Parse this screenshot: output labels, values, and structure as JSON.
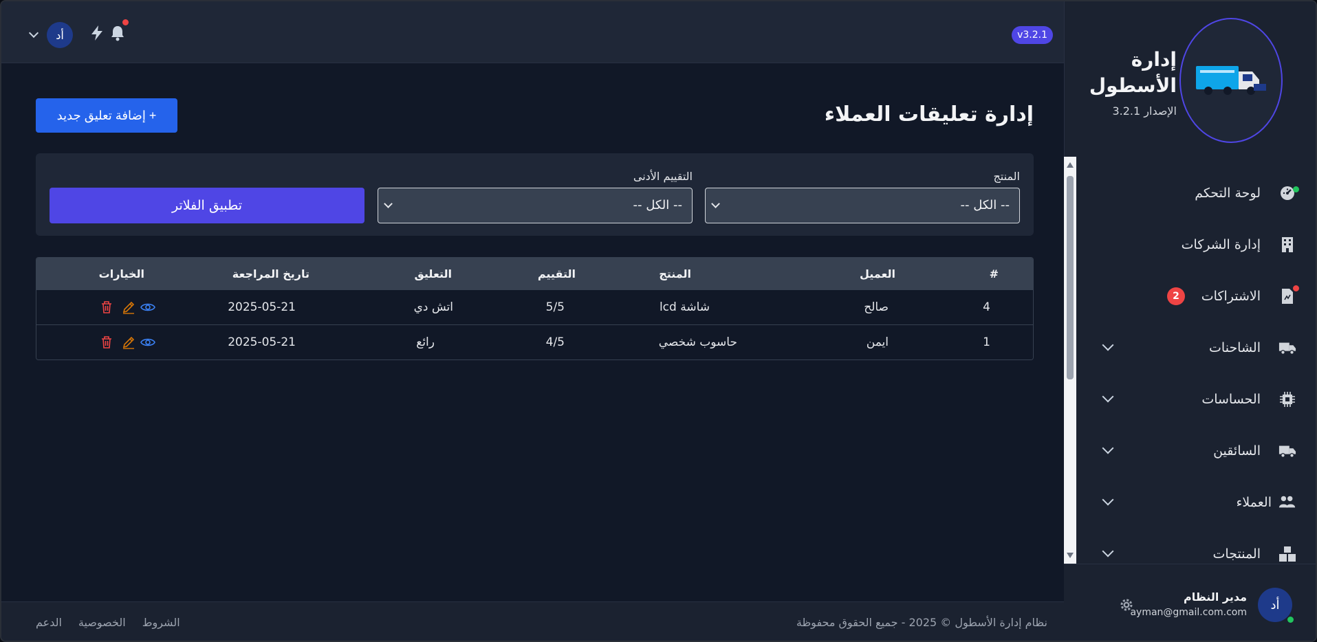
{
  "topbar": {
    "version_badge": "v3.2.1",
    "avatar_initials": "أد"
  },
  "brand": {
    "title": "إدارة الأسطول",
    "version": "الإصدار 3.2.1"
  },
  "nav": {
    "items": [
      {
        "label": "لوحة التحكم",
        "icon": "dashboard-icon"
      },
      {
        "label": "إدارة الشركات",
        "icon": "building-icon"
      },
      {
        "label": "الاشتراكات",
        "icon": "document-icon",
        "badge": "2"
      },
      {
        "label": "الشاحنات",
        "icon": "truck-icon"
      },
      {
        "label": "الحساسات",
        "icon": "chip-icon"
      },
      {
        "label": "السائقين",
        "icon": "truck-icon"
      },
      {
        "label": "العملاء",
        "icon": "users-icon"
      },
      {
        "label": "المنتجات",
        "icon": "boxes-icon"
      }
    ]
  },
  "user": {
    "avatar_initials": "أد",
    "name": "مدير النظام",
    "email": "ayman@gmail.com.com"
  },
  "page": {
    "title": "إدارة تعليقات العملاء",
    "add_button": "+ إضافة تعليق جديد"
  },
  "filters": {
    "product_label": "المنتج",
    "product_value": "-- الكل --",
    "rating_label": "التقييم الأدنى",
    "rating_value": "-- الكل --",
    "apply_button": "تطبيق الفلاتر"
  },
  "table": {
    "headers": {
      "id": "#",
      "customer": "العميل",
      "product": "المنتج",
      "rating": "التقييم",
      "comment": "التعليق",
      "review_date": "تاريخ المراجعة",
      "options": "الخيارات"
    },
    "rows": [
      {
        "id": "4",
        "customer": "صالح",
        "product": "شاشة lcd",
        "rating": "5/5",
        "comment": "اتش دي",
        "review_date": "2025-05-21"
      },
      {
        "id": "1",
        "customer": "ايمن",
        "product": "حاسوب شخصي",
        "rating": "4/5",
        "comment": "رائع",
        "review_date": "2025-05-21"
      }
    ]
  },
  "footer": {
    "copyright": "نظام إدارة الأسطول © 2025 - جميع الحقوق محفوظة",
    "links": [
      "الشروط",
      "الخصوصية",
      "الدعم"
    ]
  },
  "colors": {
    "accent": "#4f46e5",
    "primary_button": "#2563eb",
    "danger": "#ef4444",
    "success": "#22c55e"
  }
}
